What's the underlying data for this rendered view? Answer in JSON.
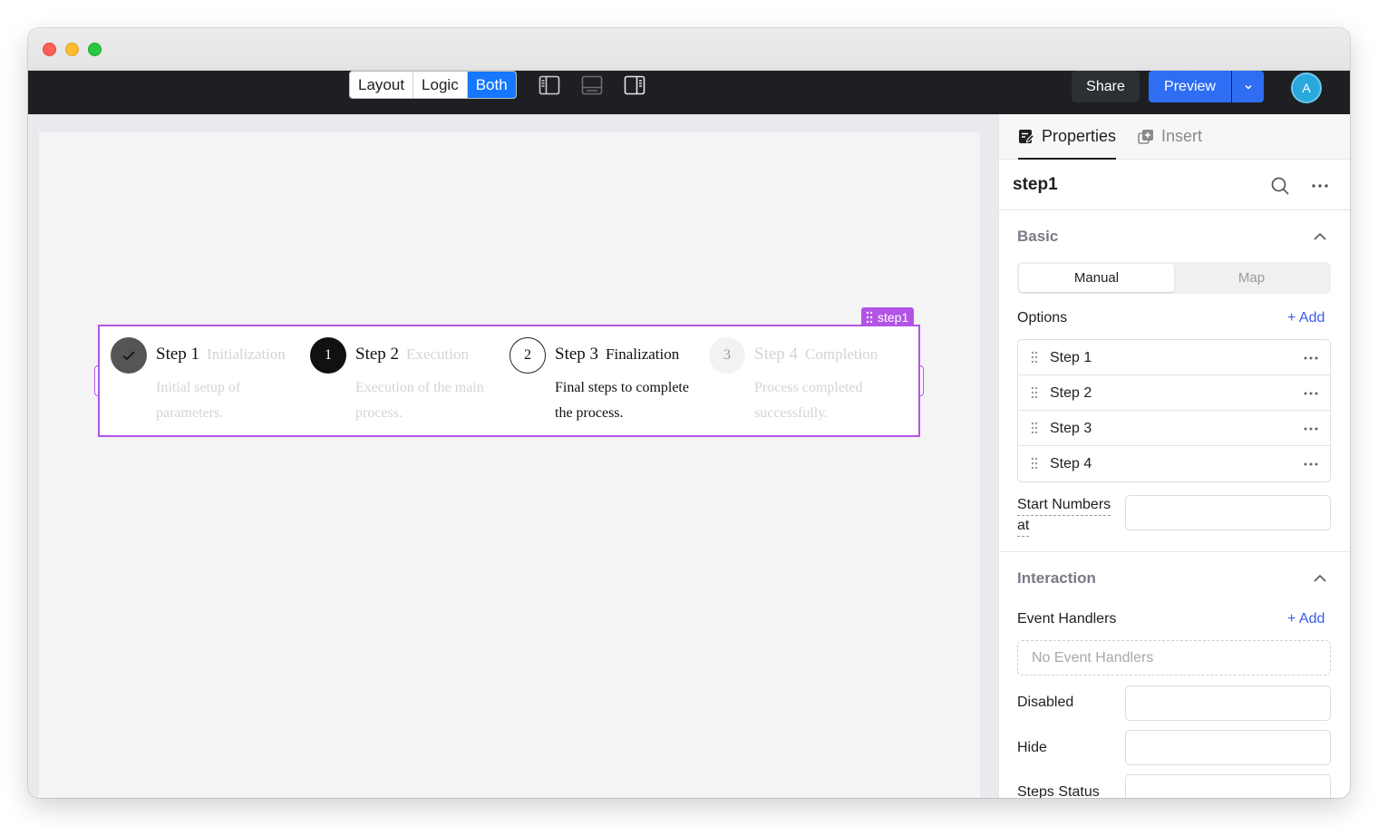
{
  "toolbar": {
    "view_modes": [
      "Layout",
      "Logic",
      "Both"
    ],
    "active_mode": "Both",
    "share_label": "Share",
    "preview_label": "Preview",
    "avatar_initial": "A"
  },
  "component": {
    "tag_label": "step1",
    "steps": [
      {
        "indicator": "✓",
        "title": "Step 1",
        "subtitle": "Initialization",
        "description_line1": "Initial setup of",
        "description_line2": "parameters.",
        "state": "finished"
      },
      {
        "indicator": "1",
        "title": "Step 2",
        "subtitle": "Execution",
        "description_line1": "Execution of the main",
        "description_line2": "process.",
        "state": "active-dark"
      },
      {
        "indicator": "2",
        "title": "Step 3",
        "subtitle": "Finalization",
        "description_line1": "Final steps to complete",
        "description_line2": "the process.",
        "state": "current"
      },
      {
        "indicator": "3",
        "title": "Step 4",
        "subtitle": "Completion",
        "description_line1": "Process completed",
        "description_line2": "successfully.",
        "state": "waiting"
      }
    ]
  },
  "panel": {
    "tab_properties": "Properties",
    "tab_insert": "Insert",
    "component_name": "step1",
    "basic_title": "Basic",
    "mode_manual": "Manual",
    "mode_map": "Map",
    "options_label": "Options",
    "add_label": "+ Add",
    "options": [
      "Step 1",
      "Step 2",
      "Step 3",
      "Step 4"
    ],
    "start_numbers_line1": "Start Numbers",
    "start_numbers_line2": "at",
    "interaction_title": "Interaction",
    "event_handlers_label": "Event Handlers",
    "event_add_label": "+ Add",
    "no_event_handlers": "No Event Handlers",
    "disabled_label": "Disabled",
    "hide_label": "Hide",
    "steps_status_label": "Steps Status"
  },
  "colors": {
    "accent": "#1677ff",
    "selection": "#b254e6",
    "preview": "#2f6df3",
    "link": "#3a5cf0"
  }
}
